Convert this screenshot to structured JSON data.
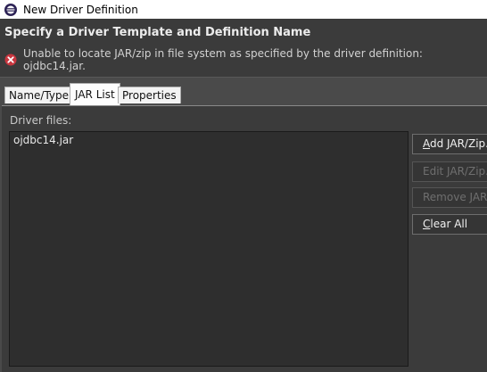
{
  "window": {
    "title": "New Driver Definition"
  },
  "banner": {
    "heading": "Specify a Driver Template and Definition Name",
    "error_message": "Unable to locate JAR/zip in file system as specified by the driver definition: ojdbc14.jar."
  },
  "tabs": [
    {
      "label": "Name/Type",
      "selected": false
    },
    {
      "label": "JAR List",
      "selected": true
    },
    {
      "label": "Properties",
      "selected": false
    }
  ],
  "jar_list": {
    "driver_files_label": "Driver files:",
    "files": [
      "ojdbc14.jar"
    ]
  },
  "buttons": {
    "add": {
      "mnemonic": "A",
      "rest": "dd JAR/Zip...",
      "enabled": true
    },
    "edit": {
      "label": "Edit JAR/Zip...",
      "enabled": false
    },
    "remove": {
      "label": "Remove JAR/Zip",
      "enabled": false
    },
    "clear": {
      "mnemonic": "C",
      "rest": "lear All",
      "enabled": true
    }
  },
  "colors": {
    "error": "#c8363f",
    "panel_bg": "#3b3b3b",
    "list_bg": "#2e2e2e"
  }
}
